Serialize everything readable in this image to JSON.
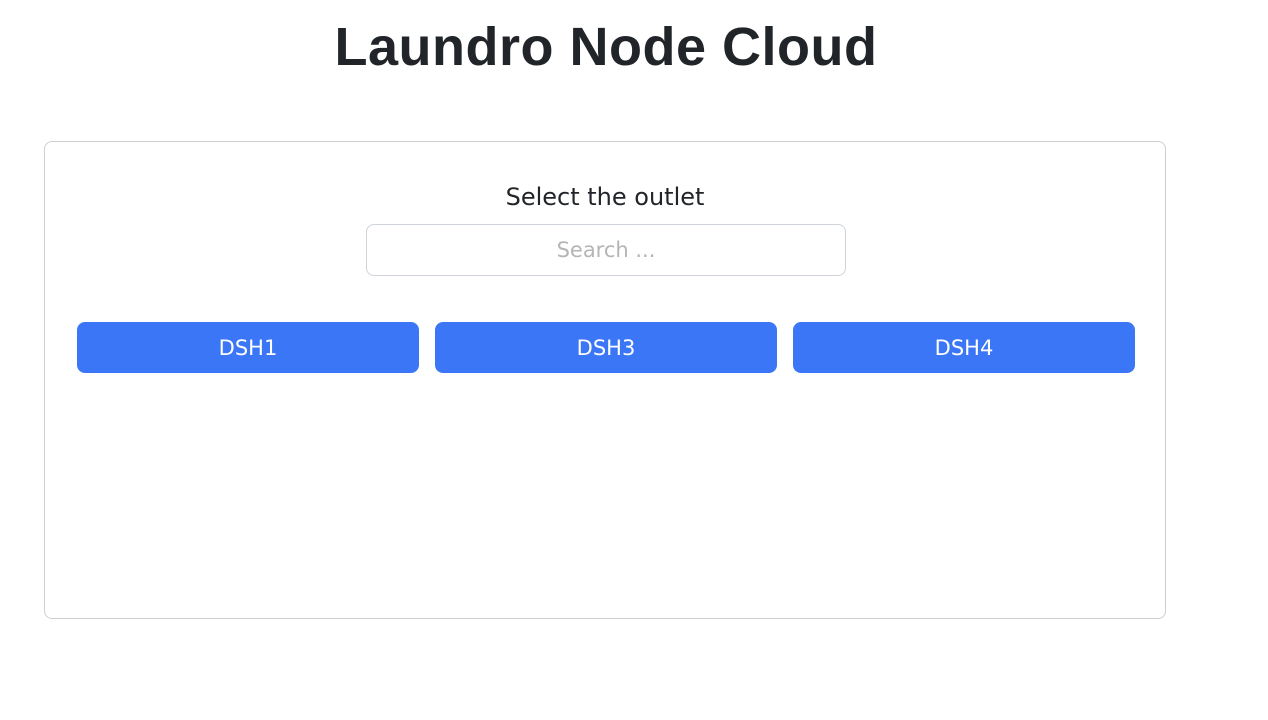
{
  "header": {
    "title": "Laundro Node Cloud"
  },
  "outlet_picker": {
    "label": "Select the outlet",
    "search": {
      "placeholder": "Search ...",
      "value": ""
    },
    "outlets": [
      {
        "label": "DSH1"
      },
      {
        "label": "DSH3"
      },
      {
        "label": "DSH4"
      }
    ]
  },
  "colors": {
    "button_background": "#3b76f6",
    "button_text": "#ffffff",
    "title_text": "#212529",
    "card_border": "#cfcfcf"
  }
}
